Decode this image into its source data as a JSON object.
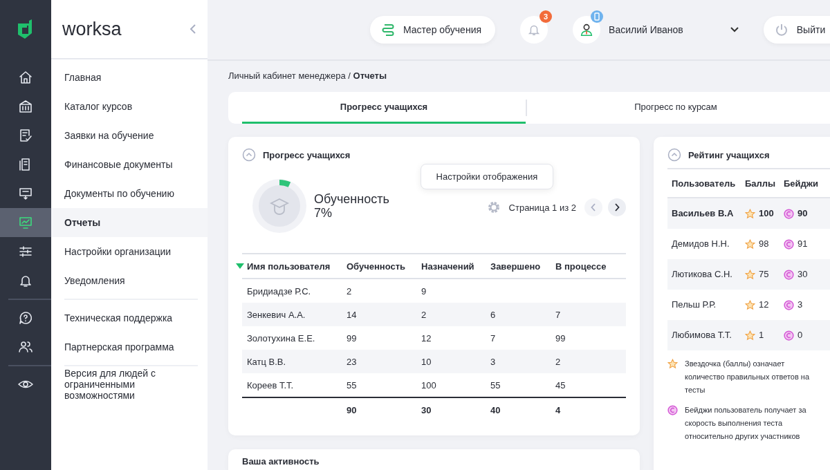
{
  "brand": {
    "name": "worksa"
  },
  "sidebar": {
    "groups": [
      {
        "items": [
          {
            "label": "Главная",
            "selected": false
          },
          {
            "label": "Каталог курсов",
            "selected": false
          },
          {
            "label": "Заявки на обучение",
            "selected": false
          },
          {
            "label": "Финансовые документы",
            "selected": false
          },
          {
            "label": "Документы по обучению",
            "selected": false
          },
          {
            "label": "Отчеты",
            "selected": true
          },
          {
            "label": "Настройки организации",
            "selected": false
          },
          {
            "label": "Уведомления",
            "selected": false
          }
        ]
      },
      {
        "items": [
          {
            "label": "Техническая поддержка",
            "selected": false
          },
          {
            "label": "Партнерская программа",
            "selected": false
          }
        ]
      },
      {
        "items": [
          {
            "label": "Версия для людей с ограниченными возможностями",
            "selected": false
          }
        ]
      }
    ]
  },
  "header": {
    "wizard_button": "Мастер обучения",
    "notifications_count": "3",
    "user_name": "Василий Иванов",
    "logout": "Выйти"
  },
  "breadcrumb": {
    "path": "Личный кабинет менеджера",
    "separator": "/",
    "current": "Отчеты"
  },
  "tabs": [
    {
      "label": "Прогресс учащихся",
      "selected": true
    },
    {
      "label": "Прогресс по курсам",
      "selected": false
    }
  ],
  "progress_card": {
    "title": "Прогресс учащихся",
    "summary_label": "Обученность",
    "summary_value": "7%",
    "level": 0.07,
    "tooltip": "Настройки отображения",
    "page_info": "Страница 1 из 2",
    "prev_disabled": true,
    "columns": [
      {
        "label": "Имя пользователя",
        "sorted": true
      },
      {
        "label": "Обученность",
        "sorted": false
      },
      {
        "label": "Назначений",
        "sorted": false
      },
      {
        "label": "Завершено",
        "sorted": false
      },
      {
        "label": "В процессе",
        "sorted": false
      }
    ],
    "rows": [
      {
        "name": "Бридиадзе Р.С.",
        "progress": "2",
        "assigned": "9"
      },
      {
        "name": "Зенкевич А.А.",
        "progress": "14",
        "assigned": "2",
        "completed": "6",
        "in_progress": "7"
      },
      {
        "name": "Золотухина Е.Е.",
        "progress": "99",
        "assigned": "12",
        "completed": "7",
        "in_progress": "99"
      },
      {
        "name": "Катц В.В.",
        "progress": "23",
        "assigned": "10",
        "completed": "3",
        "in_progress": "2"
      },
      {
        "name": "Кореев Т.Т.",
        "progress": "55",
        "assigned": "100",
        "completed": "55",
        "in_progress": "45"
      }
    ],
    "totals": {
      "progress": "90",
      "assigned": "30",
      "completed": "40",
      "in_progress": "4"
    }
  },
  "activity_card": {
    "title": "Ваша активность"
  },
  "rating_card": {
    "title": "Рейтинг учащихся",
    "columns": [
      "Пользователь",
      "Баллы",
      "Бейджи"
    ],
    "rows": [
      {
        "name": "Васильев В.А",
        "points": "100",
        "badges": "90",
        "highlighted": true
      },
      {
        "name": "Демидов Н.Н.",
        "points": "98",
        "badges": "91",
        "highlighted": false
      },
      {
        "name": "Лютикова С.Н.",
        "points": "75",
        "badges": "30",
        "highlighted": false
      },
      {
        "name": "Пельш Р.Р.",
        "points": "12",
        "badges": "3",
        "highlighted": false
      },
      {
        "name": "Любимова Т.Т.",
        "points": "1",
        "badges": "0",
        "highlighted": false
      }
    ],
    "legend": [
      {
        "kind": "star",
        "text": "Звездочка (баллы) означает количество правильных ответов на тесты"
      },
      {
        "kind": "badge",
        "text": "Бейджи пользователь получает за скорость выполнения теста относительно других участников"
      }
    ]
  }
}
